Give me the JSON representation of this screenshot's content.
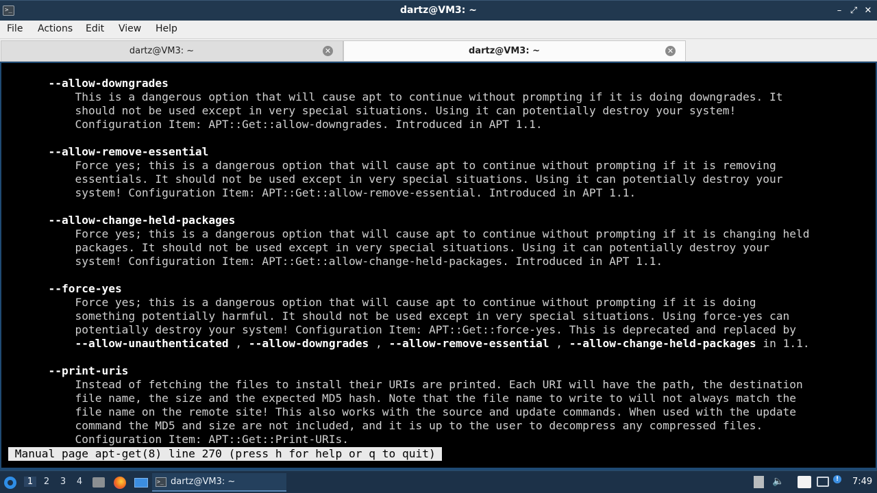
{
  "window": {
    "title": "dartz@VM3: ~",
    "app_icon": "terminal-icon",
    "minimize_icon": "minimize-icon",
    "maximize_icon": "maximize-icon",
    "close_icon": "close-icon"
  },
  "menu": {
    "file": "File",
    "actions": "Actions",
    "edit": "Edit",
    "view": "View",
    "help": "Help"
  },
  "tabs": [
    {
      "label": "dartz@VM3: ~",
      "active": false
    },
    {
      "label": "dartz@VM3: ~",
      "active": true
    }
  ],
  "terminal": {
    "lines": [
      [
        {
          "t": ""
        }
      ],
      [
        {
          "t": "      "
        },
        {
          "t": "--allow-downgrades",
          "b": true
        }
      ],
      [
        {
          "t": "          This is a dangerous option that will cause apt to continue without prompting if it is doing downgrades. It"
        }
      ],
      [
        {
          "t": "          should not be used except in very special situations. Using it can potentially destroy your system!"
        }
      ],
      [
        {
          "t": "          Configuration Item: APT::Get::allow-downgrades. Introduced in APT 1.1."
        }
      ],
      [
        {
          "t": ""
        }
      ],
      [
        {
          "t": "      "
        },
        {
          "t": "--allow-remove-essential",
          "b": true
        }
      ],
      [
        {
          "t": "          Force yes; this is a dangerous option that will cause apt to continue without prompting if it is removing"
        }
      ],
      [
        {
          "t": "          essentials. It should not be used except in very special situations. Using it can potentially destroy your"
        }
      ],
      [
        {
          "t": "          system! Configuration Item: APT::Get::allow-remove-essential. Introduced in APT 1.1."
        }
      ],
      [
        {
          "t": ""
        }
      ],
      [
        {
          "t": "      "
        },
        {
          "t": "--allow-change-held-packages",
          "b": true
        }
      ],
      [
        {
          "t": "          Force yes; this is a dangerous option that will cause apt to continue without prompting if it is changing held"
        }
      ],
      [
        {
          "t": "          packages. It should not be used except in very special situations. Using it can potentially destroy your"
        }
      ],
      [
        {
          "t": "          system! Configuration Item: APT::Get::allow-change-held-packages. Introduced in APT 1.1."
        }
      ],
      [
        {
          "t": ""
        }
      ],
      [
        {
          "t": "      "
        },
        {
          "t": "--force-yes",
          "b": true
        }
      ],
      [
        {
          "t": "          Force yes; this is a dangerous option that will cause apt to continue without prompting if it is doing"
        }
      ],
      [
        {
          "t": "          something potentially harmful. It should not be used except in very special situations. Using force-yes can"
        }
      ],
      [
        {
          "t": "          potentially destroy your system! Configuration Item: APT::Get::force-yes. This is deprecated and replaced by"
        }
      ],
      [
        {
          "t": "          "
        },
        {
          "t": "--allow-unauthenticated",
          "b": true
        },
        {
          "t": " , "
        },
        {
          "t": "--allow-downgrades",
          "b": true
        },
        {
          "t": " , "
        },
        {
          "t": "--allow-remove-essential",
          "b": true
        },
        {
          "t": " , "
        },
        {
          "t": "--allow-change-held-packages",
          "b": true
        },
        {
          "t": " in 1.1."
        }
      ],
      [
        {
          "t": ""
        }
      ],
      [
        {
          "t": "      "
        },
        {
          "t": "--print-uris",
          "b": true
        }
      ],
      [
        {
          "t": "          Instead of fetching the files to install their URIs are printed. Each URI will have the path, the destination"
        }
      ],
      [
        {
          "t": "          file name, the size and the expected MD5 hash. Note that the file name to write to will not always match the"
        }
      ],
      [
        {
          "t": "          file name on the remote site! This also works with the source and update commands. When used with the update"
        }
      ],
      [
        {
          "t": "          command the MD5 and size are not included, and it is up to the user to decompress any compressed files."
        }
      ],
      [
        {
          "t": "          Configuration Item: APT::Get::Print-URIs."
        }
      ]
    ],
    "status": " Manual page apt-get(8) line 270 (press h for help or q to quit) "
  },
  "taskbar": {
    "start_icon": "start-menu-icon",
    "workspaces": [
      "1",
      "2",
      "3",
      "4"
    ],
    "active_workspace": "1",
    "launchers": [
      "file-manager-icon",
      "firefox-icon",
      "show-desktop-icon"
    ],
    "task_label": "dartz@VM3: ~",
    "tray": [
      "clipboard-icon",
      "volume-icon",
      "battery-icon",
      "monitor-icon",
      "notification-icon"
    ],
    "clock": "7:49"
  }
}
